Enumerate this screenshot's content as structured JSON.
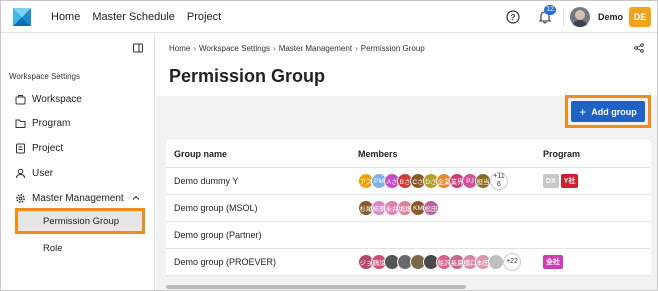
{
  "topbar": {
    "nav": [
      "Home",
      "Master Schedule",
      "Project"
    ],
    "notification_count": "12",
    "user_name": "Demo",
    "user_initials": "DE"
  },
  "sidebar": {
    "heading": "Workspace Settings",
    "items": [
      {
        "label": "Workspace",
        "icon": "workspace-icon"
      },
      {
        "label": "Program",
        "icon": "program-icon"
      },
      {
        "label": "Project",
        "icon": "project-icon"
      },
      {
        "label": "User",
        "icon": "user-icon"
      },
      {
        "label": "Master Management",
        "icon": "gear-icon"
      }
    ],
    "sub_items": [
      "Permission Group",
      "Role"
    ]
  },
  "main": {
    "breadcrumb": [
      "Home",
      "Workspace Settings",
      "Master Management",
      "Permission Group"
    ],
    "title": "Permission Group",
    "add_label": "Add group",
    "columns": [
      "Group name",
      "Members",
      "Program"
    ],
    "rows": [
      {
        "name": "Demo dummy Y",
        "members": [
          {
            "t": "アス",
            "c": "#e8a317"
          },
          {
            "t": "PM",
            "c": "#7fb3e8"
          },
          {
            "t": "Aさ",
            "c": "#c84bc9"
          },
          {
            "t": "Bさ",
            "c": "#d03b3b"
          },
          {
            "t": "Cさ",
            "c": "#8a5a2b"
          },
          {
            "t": "Dさ",
            "c": "#b0a12a"
          },
          {
            "t": "企業",
            "c": "#e88a2b"
          },
          {
            "t": "業界",
            "c": "#c83f7a"
          },
          {
            "t": "PJ",
            "c": "#d64f9b"
          },
          {
            "t": "担当",
            "c": "#8a6a2b"
          }
        ],
        "more": "+11\n6",
        "programs": [
          {
            "t": "DX",
            "c": "#c8c8c8"
          },
          {
            "t": "Y社",
            "c": "#cc1f2f"
          }
        ]
      },
      {
        "name": "Demo group (MSOL)",
        "members": [
          {
            "t": "杉尾",
            "c": "#8a5a2b"
          },
          {
            "t": "柿原",
            "c": "#d889c9"
          },
          {
            "t": "永井",
            "c": "#e07fb0"
          },
          {
            "t": "堀畑",
            "c": "#d9849b"
          },
          {
            "t": "KM",
            "c": "#8a5a2b"
          },
          {
            "t": "松田",
            "c": "#b8609b"
          }
        ],
        "more": "",
        "programs": []
      },
      {
        "name": "Demo group (Partner)",
        "members": [],
        "more": "",
        "programs": []
      },
      {
        "name": "Demo group (PROEVER)",
        "members": [
          {
            "t": "ジョ",
            "c": "#b54a6a"
          },
          {
            "t": "鶴諒",
            "c": "#c8507a"
          },
          {
            "t": "",
            "c": "#555555"
          },
          {
            "t": "",
            "c": "#6a6a6a"
          },
          {
            "t": "",
            "c": "#7a6a4a"
          },
          {
            "t": "",
            "c": "#4a4a4a"
          },
          {
            "t": "船沢",
            "c": "#d95f8f"
          },
          {
            "t": "長夏",
            "c": "#c96a8a"
          },
          {
            "t": "橋口",
            "c": "#d889a9"
          },
          {
            "t": "本田",
            "c": "#d99ab0"
          },
          {
            "t": "",
            "c": "#c0c0c0"
          }
        ],
        "more": "+22",
        "programs": [
          {
            "t": "全社",
            "c": "#cc3fb0"
          }
        ]
      }
    ]
  },
  "colors": {
    "accent": "#1e62c4",
    "highlight": "#f08c1a",
    "initials_bg": "#f0a31c"
  }
}
